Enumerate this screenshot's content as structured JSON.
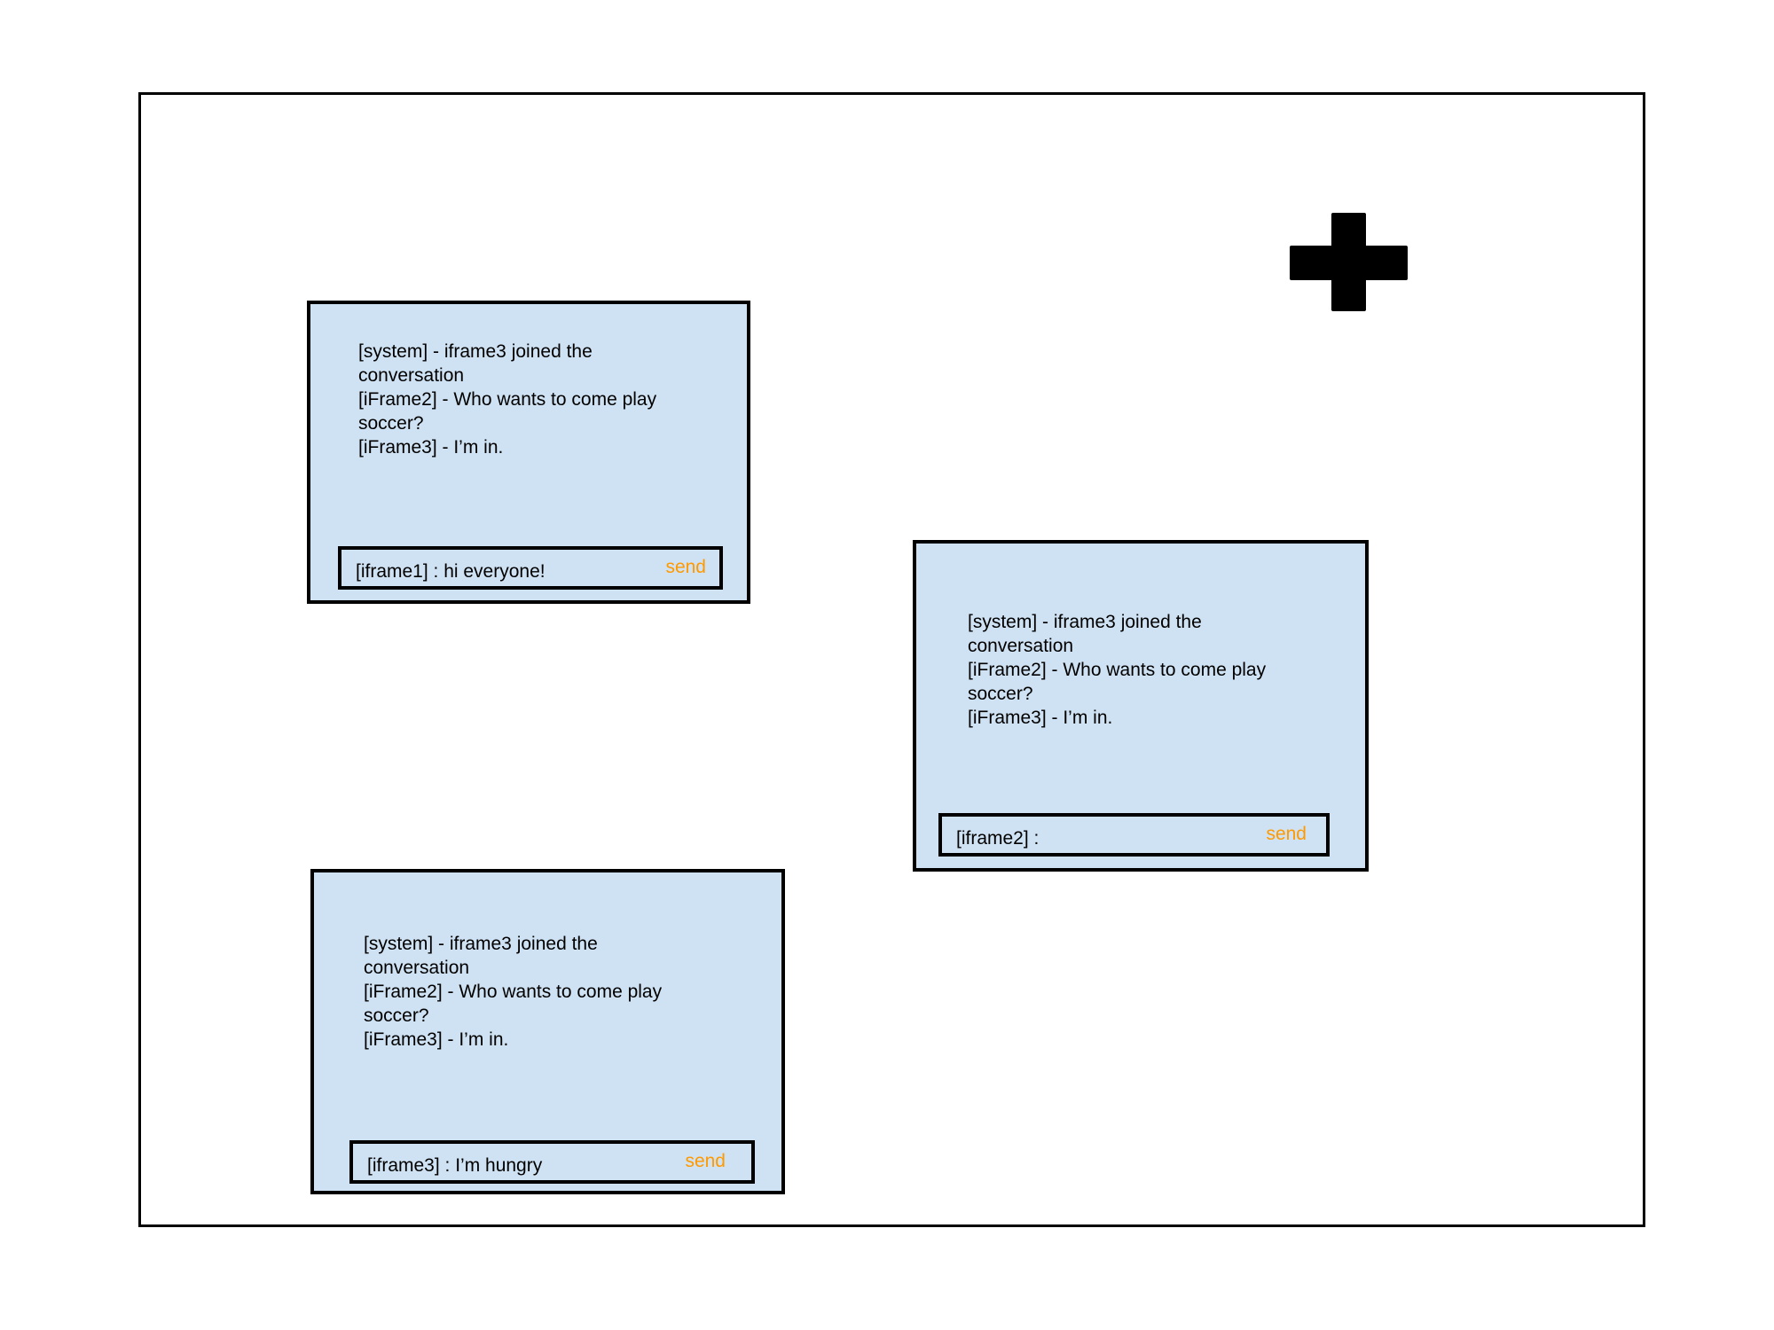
{
  "colors": {
    "window_bg": "#cfe2f3",
    "border": "#000000",
    "send": "#ff9900"
  },
  "add_button": {
    "icon": "plus-icon"
  },
  "windows": [
    {
      "log": [
        "[system] - iframe3 joined the",
        "conversation",
        "[iFrame2] - Who wants to come play",
        "soccer?",
        "[iFrame3] - I’m in."
      ],
      "input_text": "[iframe1] : hi everyone!",
      "send_label": "send"
    },
    {
      "log": [
        "[system] - iframe3 joined the",
        "conversation",
        "[iFrame2] - Who wants to come play",
        "soccer?",
        "[iFrame3] - I’m in."
      ],
      "input_text": "[iframe2] :",
      "send_label": "send"
    },
    {
      "log": [
        "[system] - iframe3 joined the",
        "conversation",
        "[iFrame2] - Who wants to come play",
        "soccer?",
        "[iFrame3] - I’m in."
      ],
      "input_text": "[iframe3] : I’m hungry",
      "send_label": "send"
    }
  ]
}
